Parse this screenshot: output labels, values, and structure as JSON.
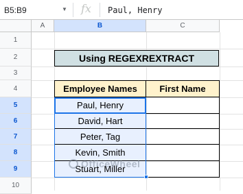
{
  "formula_bar": {
    "name_box": "B5:B9",
    "fx_label": "fx",
    "value": "Paul, Henry"
  },
  "columns": [
    "A",
    "B",
    "C"
  ],
  "rows": [
    "1",
    "2",
    "3",
    "4",
    "5",
    "6",
    "7",
    "8",
    "9",
    "10"
  ],
  "sheet": {
    "title": "Using REGEXREXTRACT",
    "header_names": "Employee Names",
    "header_first": "First Name",
    "names": [
      "Paul, Henry",
      "David, Hart",
      "Peter, Tag",
      "Kevin, Smith",
      "Stuart, Miller"
    ]
  },
  "watermark": "OfficeWheel",
  "colors": {
    "title_fill": "#d0e0e3",
    "header_fill": "#fff2cc",
    "selection": "#1a73e8"
  }
}
